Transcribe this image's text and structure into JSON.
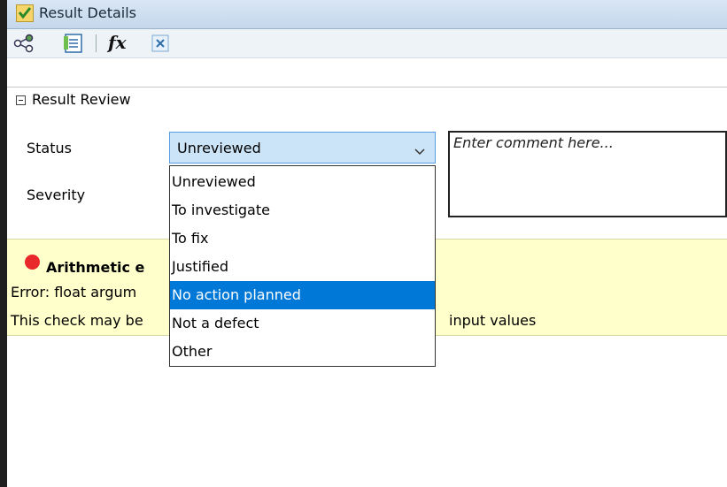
{
  "window": {
    "title": "Result Details"
  },
  "toolbar": {
    "icons": [
      "share-graph-icon",
      "export-list-icon",
      "function-icon",
      "variable-icon"
    ],
    "fx_label": "fx"
  },
  "section": {
    "title": "Result Review"
  },
  "form": {
    "status_label": "Status",
    "severity_label": "Severity",
    "status_value": "Unreviewed",
    "comment_placeholder": "Enter comment here..."
  },
  "status_options": [
    "Unreviewed",
    "To investigate",
    "To fix",
    "Justified",
    "No action planned",
    "Not a defect",
    "Other"
  ],
  "highlighted_option": "No action planned",
  "result": {
    "check_title": "Arithmetic e",
    "error_text": "Error: float argum",
    "info_text": "This check may be",
    "info_tail": "input values"
  },
  "colors": {
    "selection": "#0078d7",
    "status_dot": "#e8282a",
    "result_background": "#ffffcc",
    "select_background": "#cce4f7"
  }
}
